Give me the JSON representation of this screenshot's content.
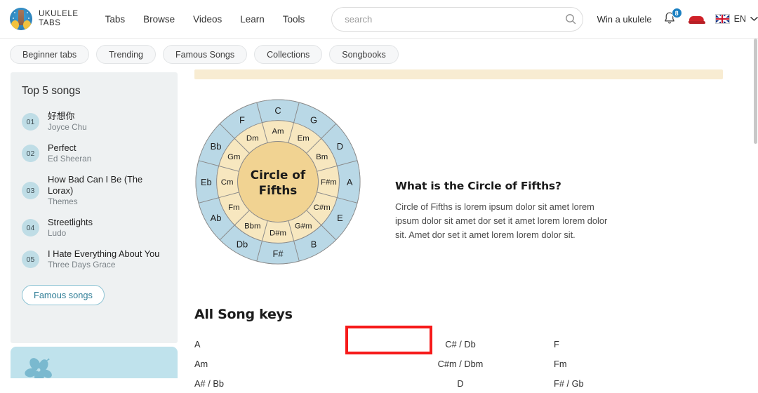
{
  "header": {
    "logo": {
      "icon": "ukulele-logo-icon",
      "line1": "UKULELE",
      "line2": "TABS"
    },
    "nav": [
      {
        "label": "Tabs"
      },
      {
        "label": "Browse"
      },
      {
        "label": "Videos"
      },
      {
        "label": "Learn"
      },
      {
        "label": "Tools"
      }
    ],
    "search": {
      "placeholder": "search",
      "value": "",
      "icon": "search-icon"
    },
    "win_link": "Win a ukulele",
    "notifications": {
      "icon": "bell-icon",
      "count": "8",
      "badge_color": "#1a7fc1"
    },
    "shoe_icon": "red-sneaker-icon",
    "language": {
      "flag": "uk-flag-icon",
      "code": "EN",
      "chevron": "chevron-down-icon"
    }
  },
  "chips": [
    {
      "label": "Beginner tabs"
    },
    {
      "label": "Trending"
    },
    {
      "label": "Famous Songs"
    },
    {
      "label": "Collections"
    },
    {
      "label": "Songbooks"
    }
  ],
  "sidebar": {
    "title": "Top 5 songs",
    "songs": [
      {
        "rank": "01",
        "title": "好想你",
        "artist": "Joyce Chu"
      },
      {
        "rank": "02",
        "title": "Perfect",
        "artist": "Ed Sheeran"
      },
      {
        "rank": "03",
        "title": "How Bad Can I Be (The Lorax)",
        "artist": "Themes"
      },
      {
        "rank": "04",
        "title": "Streetlights",
        "artist": "Ludo"
      },
      {
        "rank": "05",
        "title": "I Hate Everything About You",
        "artist": "Three Days Grace"
      }
    ],
    "famous_button": "Famous songs",
    "promo_icon": "hibiscus-flower-icon"
  },
  "main": {
    "circle_of_fifths": {
      "center_line1": "Circle of",
      "center_line2": "Fifths",
      "outer_ring": [
        "C",
        "G",
        "D",
        "A",
        "E",
        "B",
        "F#",
        "Db",
        "Ab",
        "Eb",
        "Bb",
        "F"
      ],
      "inner_ring": [
        "Am",
        "Em",
        "Bm",
        "F#m",
        "C#m",
        "G#m",
        "D#m",
        "Bbm",
        "Fm",
        "Cm",
        "Gm",
        "Dm"
      ],
      "outer_color": "#b9d8e6",
      "inner_color": "#f7e7bf",
      "center_color": "#f1d392",
      "stroke_color": "#8a8a8a"
    },
    "info": {
      "heading": "What is the Circle of Fifths?",
      "body": "Circle of Fifths is lorem ipsum dolor sit amet lorem ipsum dolor sit amet dor set it amet lorem lorem dolor sit. Amet dor set it amet lorem lorem dolor sit."
    },
    "keys_title": "All Song keys",
    "keys_rows": [
      {
        "col1": "A",
        "col2": "C# / Db",
        "col3": "F"
      },
      {
        "col1": "Am",
        "col2": "C#m / Dbm",
        "col3": "Fm"
      },
      {
        "col1": "A# / Bb",
        "col2": "D",
        "col3": "F# / Gb"
      }
    ],
    "highlight": {
      "target": "C# / Db",
      "color": "#f61a1a"
    }
  }
}
